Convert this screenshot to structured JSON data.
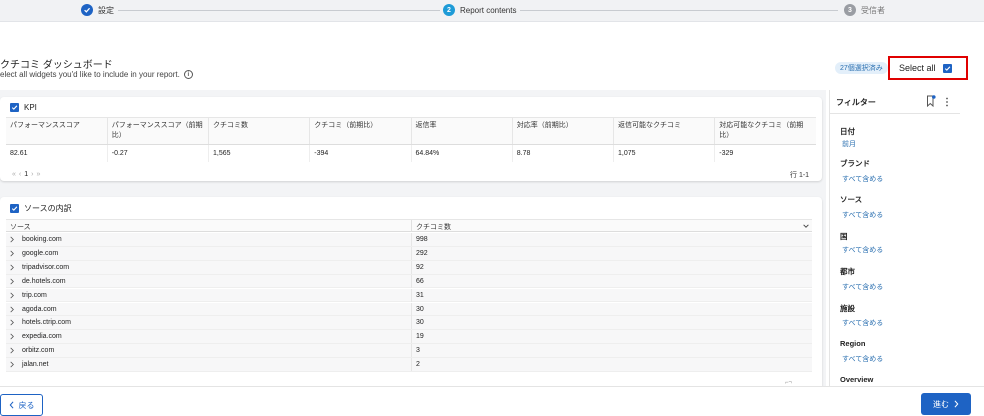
{
  "stepper": {
    "steps": [
      {
        "label": "設定",
        "number": "✓",
        "state": "done"
      },
      {
        "label": "Report contents",
        "number": "2",
        "state": "active"
      },
      {
        "label": "受信者",
        "number": "3",
        "state": "pending"
      }
    ]
  },
  "page": {
    "title": "クチコミ ダッシュボード",
    "subtitle": "elect all widgets you'd like to include in your report.",
    "info_icon": "i"
  },
  "selection": {
    "badge": "27個選択済み",
    "select_all_label": "Select all",
    "select_all_checked": true
  },
  "kpi": {
    "title": "KPI",
    "checked": true,
    "columns": [
      "パフォーマンススコア",
      "パフォーマンススコア（前期比）",
      "クチコミ数",
      "クチコミ（前期比）",
      "返信率",
      "対応率（前期比）",
      "返信可能なクチコミ",
      "対応可能なクチコミ（前期比）"
    ],
    "row": [
      "82.61",
      "-0.27",
      "1,565",
      "-394",
      "64.84%",
      "8.78",
      "1,075",
      "-329"
    ],
    "pager": {
      "first": "«",
      "prev": "‹",
      "current": "1",
      "next": "›",
      "last": "»"
    },
    "row_count": "行 1-1"
  },
  "sources": {
    "title": "ソースの内訳",
    "checked": true,
    "col_source": "ソース",
    "col_count": "クチコミ数",
    "rows": [
      {
        "name": "booking.com",
        "value": "998"
      },
      {
        "name": "google.com",
        "value": "292"
      },
      {
        "name": "tripadvisor.com",
        "value": "92"
      },
      {
        "name": "de.hotels.com",
        "value": "66"
      },
      {
        "name": "trip.com",
        "value": "31"
      },
      {
        "name": "agoda.com",
        "value": "30"
      },
      {
        "name": "hotels.ctrip.com",
        "value": "30"
      },
      {
        "name": "expedia.com",
        "value": "19"
      },
      {
        "name": "orbitz.com",
        "value": "3"
      },
      {
        "name": "jalan.net",
        "value": "2"
      }
    ]
  },
  "filters": {
    "title": "フィルター",
    "items": [
      {
        "label": "日付",
        "value": "前月"
      },
      {
        "label": "ブランド",
        "value": "すべて含める"
      },
      {
        "label": "ソース",
        "value": "すべて含める"
      },
      {
        "label": "国",
        "value": "すべて含める"
      },
      {
        "label": "都市",
        "value": "すべて含める"
      },
      {
        "label": "施設",
        "value": "すべて含める"
      },
      {
        "label": "Region",
        "value": "すべて含める"
      },
      {
        "label": "Overview",
        "value": ""
      }
    ]
  },
  "footer": {
    "back_label": "戻る",
    "next_label": "進む"
  },
  "colors": {
    "accent": "#1e63c4",
    "highlight_border": "#e00000",
    "step_done": "#1e63c4",
    "step_active": "#1e9bd7",
    "step_pending": "#9a9da3"
  }
}
